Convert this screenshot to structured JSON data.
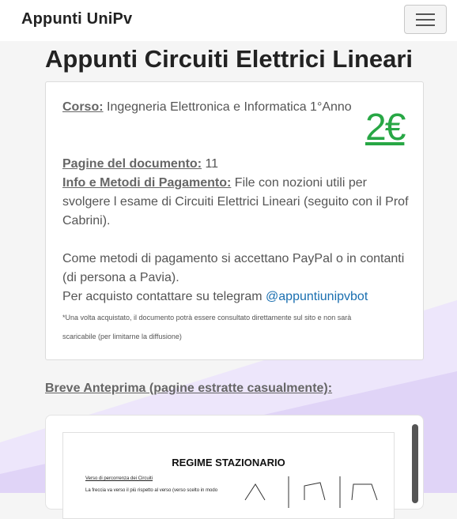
{
  "navbar": {
    "brand": "Appunti UniPv"
  },
  "page": {
    "title": "Appunti Circuiti Elettrici Lineari"
  },
  "card": {
    "course_label": "Corso:",
    "course_value": " Ingegneria Elettronica e Informatica 1°Anno",
    "price": "2€",
    "pages_label": "Pagine del documento:",
    "pages_value": " 11",
    "info_label": "Info e Metodi di Pagamento:",
    "info_line1": " File con nozioni utili per",
    "info_line2": "svolgere l esame di Circuiti Elettrici Lineari (seguito con il Prof",
    "info_line3": "Cabrini).",
    "payment_line1": "Come metodi di pagamento si accettano PayPal o in contanti",
    "payment_line2": "(di persona a Pavia).",
    "telegram_text": "Per acquisto contattare su telegram ",
    "telegram_handle": "@appuntiunipvbot",
    "note_line1": "*Una volta acquistato, il documento potrà essere consultato direttamente sul sito e non sarà",
    "note_line2": "scaricabile (per limitarne la diffusione)"
  },
  "preview": {
    "heading": "Breve Anteprima (pagine estratte casualmente):",
    "doc_title": "REGIME STAZIONARIO",
    "doc_subtitle": "Verso di percorrenza dei Circuiti",
    "doc_line": "La freccia va verso il più rispetto al verso (verso scelto in modo"
  },
  "colors": {
    "price": "#28a745",
    "link": "#1a6fb0",
    "background_accent": "#e6dcf9"
  }
}
